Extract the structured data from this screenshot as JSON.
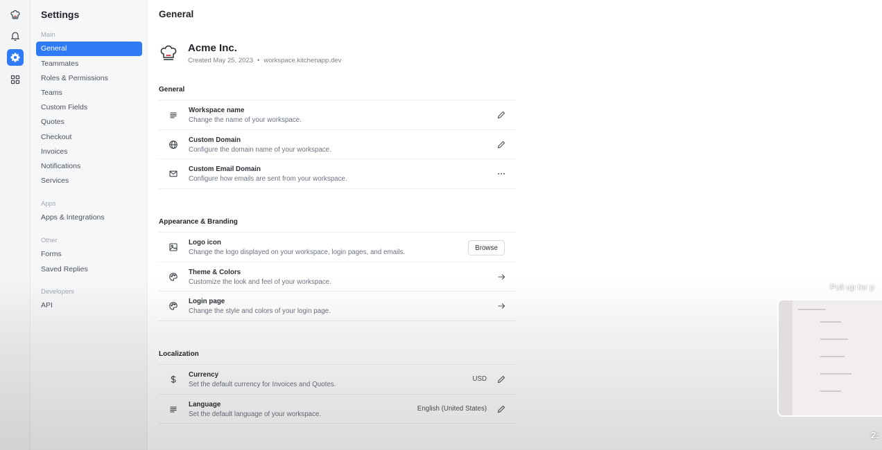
{
  "sidebar": {
    "title": "Settings",
    "groups": [
      {
        "label": "Main",
        "items": [
          "General",
          "Teammates",
          "Roles & Permissions",
          "Teams",
          "Custom Fields",
          "Quotes",
          "Checkout",
          "Invoices",
          "Notifications",
          "Services"
        ]
      },
      {
        "label": "Apps",
        "items": [
          "Apps & Integrations"
        ]
      },
      {
        "label": "Other",
        "items": [
          "Forms",
          "Saved Replies"
        ]
      },
      {
        "label": "Developers",
        "items": [
          "API"
        ]
      }
    ],
    "active_item": "General"
  },
  "rail": {
    "icons": [
      "chef-hat-logo-icon",
      "bell-icon",
      "gear-icon",
      "grid-icon"
    ],
    "active": "gear-icon"
  },
  "main": {
    "page_title": "General",
    "workspace": {
      "name": "Acme Inc.",
      "created": "Created May 25, 2023",
      "separator": "•",
      "domain": "workspace.kitchenapp.dev"
    },
    "sections": {
      "general": {
        "title": "General",
        "rows": [
          {
            "title": "Workspace name",
            "desc": "Change the name of your workspace.",
            "icon": "text-lines-icon",
            "action": "pencil-icon"
          },
          {
            "title": "Custom Domain",
            "desc": "Configure the domain name of your workspace.",
            "icon": "globe-icon",
            "action": "pencil-icon"
          },
          {
            "title": "Custom Email Domain",
            "desc": "Configure how emails are sent from your workspace.",
            "icon": "mail-icon",
            "action": "more-dots-icon"
          }
        ]
      },
      "appearance": {
        "title": "Appearance & Branding",
        "rows": [
          {
            "title": "Logo icon",
            "desc": "Change the logo displayed on your workspace, login pages, and emails.",
            "icon": "image-icon",
            "button": "Browse"
          },
          {
            "title": "Theme & Colors",
            "desc": "Customize the look and feel of your workspace.",
            "icon": "palette-icon",
            "action": "arrow-right-icon"
          },
          {
            "title": "Login page",
            "desc": "Change the style and colors of your login page.",
            "icon": "palette-icon",
            "action": "arrow-right-icon"
          }
        ]
      },
      "localization": {
        "title": "Localization",
        "rows": [
          {
            "title": "Currency",
            "desc": "Set the default currency for Invoices and Quotes.",
            "icon": "dollar-icon",
            "value": "USD",
            "action": "pencil-icon"
          },
          {
            "title": "Language",
            "desc": "Set the default language of your workspace.",
            "icon": "text-lines-icon",
            "value": "English (United States)",
            "action": "pencil-icon"
          }
        ]
      }
    }
  },
  "video_overlay": {
    "pull_hint": "Pull up for p",
    "timestamp": "2:"
  },
  "colors": {
    "accent": "#2f7bf5",
    "sidebar_bg": "#f6f7f9",
    "rail_bg": "#f3f4f6"
  }
}
